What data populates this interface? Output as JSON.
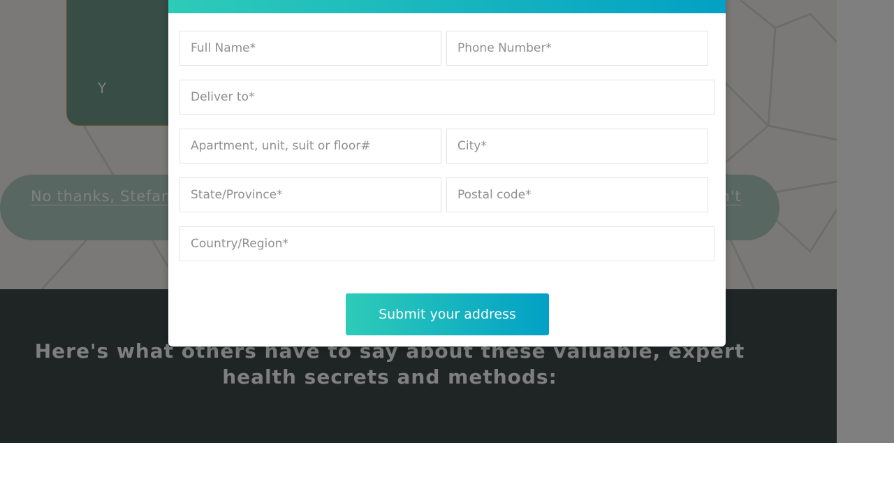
{
  "background": {
    "offer_card_text": "Y",
    "decline_link": "No thanks, Stefan",
    "decline_link_end": "on't",
    "testimonials_heading": "Here's what others have to say about these valuable, expert health secrets and methods:"
  },
  "form": {
    "fields": {
      "full_name": {
        "placeholder": "Full Name*"
      },
      "phone": {
        "placeholder": "Phone Number*"
      },
      "deliver_to": {
        "placeholder": "Deliver to*"
      },
      "apartment": {
        "placeholder": "Apartment, unit, suit or floor#"
      },
      "city": {
        "placeholder": "City*"
      },
      "state": {
        "placeholder": "State/Province*"
      },
      "postal": {
        "placeholder": "Postal code*"
      },
      "country": {
        "placeholder": "Country/Region*"
      }
    },
    "submit_label": "Submit your address"
  },
  "colors": {
    "accent_start": "#2ecbb8",
    "accent_end": "#02a1c5",
    "testimonials_bg": "#3d4a48"
  }
}
